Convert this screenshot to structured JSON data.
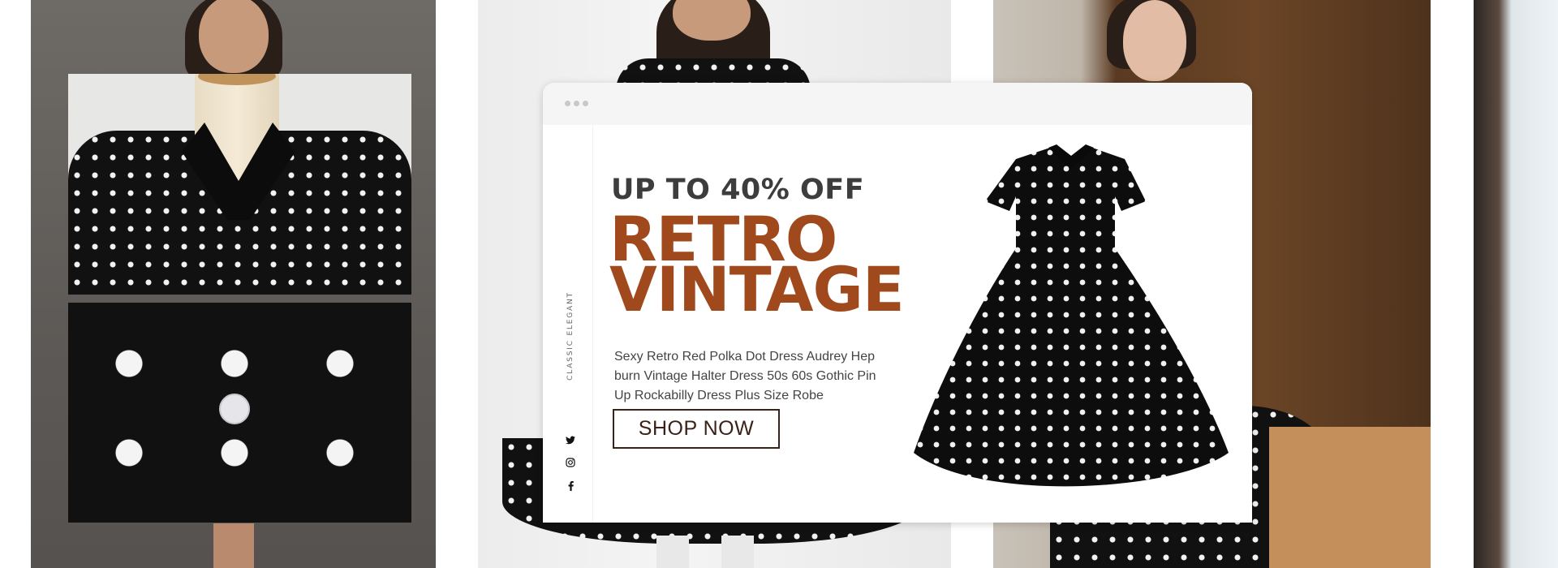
{
  "popup": {
    "side_label": "CLASSIC ELEGANT",
    "discount": "UP TO 40% OFF",
    "headline_line1": "RETRO",
    "headline_line2": "VINTAGE",
    "description": "Sexy Retro Red Polka Dot Dress Audrey Hepburn Vintage Halter Dress 50s 60s Gothic Pin Up Rockabilly Dress Plus Size Robe",
    "cta_label": "SHOP NOW",
    "social_icons": [
      "twitter-icon",
      "instagram-icon",
      "facebook-icon"
    ]
  },
  "colors": {
    "headline": "#a0491d",
    "discount": "#3d3d3d",
    "cta_border": "#3b2218",
    "window_bar": "#f5f5f5"
  }
}
